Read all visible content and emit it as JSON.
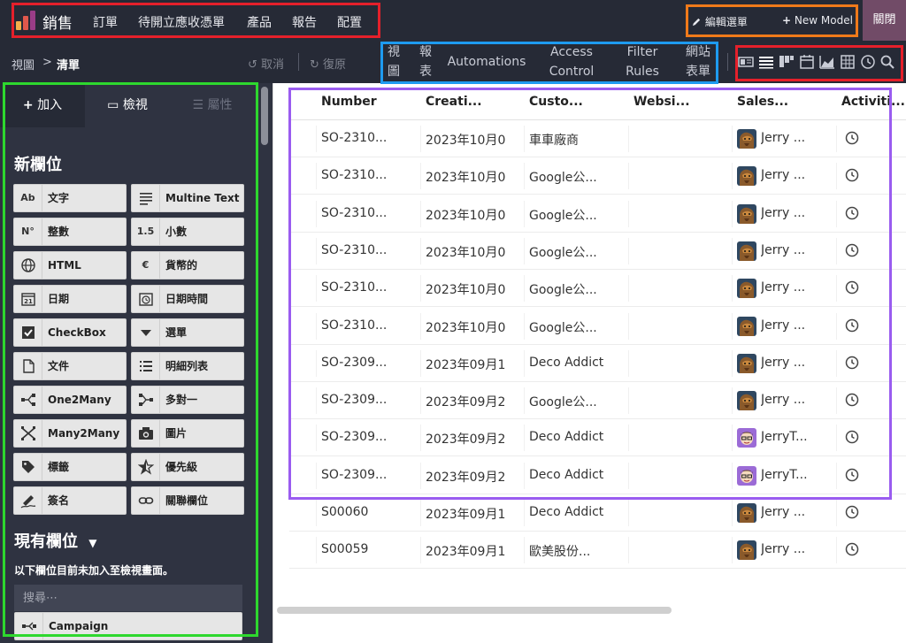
{
  "app": {
    "title": "銷售",
    "menu": [
      "訂單",
      "待開立應收憑單",
      "產品",
      "報告",
      "配置"
    ],
    "edit_menu": "編輯選單",
    "new_model": "New Model",
    "close": "關閉"
  },
  "toolbar": {
    "breadcrumb_root": "視圖",
    "breadcrumb_sep": ">",
    "breadcrumb_current": "清單",
    "undo": "取消",
    "redo": "復原",
    "view_tabs": [
      {
        "l1": "視",
        "l2": "圖"
      },
      {
        "l1": "報",
        "l2": "表"
      },
      {
        "l1": "Automations",
        "l2": ""
      },
      {
        "l1": "Access",
        "l2": "Control"
      },
      {
        "l1": "Filter",
        "l2": "Rules"
      },
      {
        "l1": "網站",
        "l2": "表單"
      }
    ],
    "view_icons": [
      "form-view-icon",
      "list-view-icon",
      "kanban-view-icon",
      "calendar-view-icon",
      "graph-view-icon",
      "pivot-view-icon",
      "activity-view-icon",
      "search-view-icon"
    ]
  },
  "sidebar": {
    "tabs": [
      "加入",
      "檢視",
      "屬性"
    ],
    "new_fields_title": "新欄位",
    "fields": [
      {
        "icon": "Ab",
        "label": "文字"
      },
      {
        "icon": "lines",
        "label": "Multine Text"
      },
      {
        "icon": "N°",
        "label": "整數"
      },
      {
        "icon": "1.5",
        "label": "小數"
      },
      {
        "icon": "globe",
        "label": "HTML"
      },
      {
        "icon": "€",
        "label": "貨幣的"
      },
      {
        "icon": "21",
        "label": "日期"
      },
      {
        "icon": "clock",
        "label": "日期時間"
      },
      {
        "icon": "check",
        "label": "CheckBox"
      },
      {
        "icon": "caret",
        "label": "選單"
      },
      {
        "icon": "file",
        "label": "文件"
      },
      {
        "icon": "list",
        "label": "明細列表"
      },
      {
        "icon": "o2m",
        "label": "One2Many"
      },
      {
        "icon": "m2o",
        "label": "多對一"
      },
      {
        "icon": "m2m",
        "label": "Many2Many"
      },
      {
        "icon": "camera",
        "label": "圖片"
      },
      {
        "icon": "tag",
        "label": "標籤"
      },
      {
        "icon": "star",
        "label": "優先級"
      },
      {
        "icon": "sign",
        "label": "簽名"
      },
      {
        "icon": "link",
        "label": "關聯欄位"
      }
    ],
    "existing_title": "現有欄位",
    "note": "以下欄位目前未加入至檢視畫面。",
    "search_placeholder": "搜尋⋯",
    "existing_fields": [
      "Campaign"
    ]
  },
  "table": {
    "headers": [
      "Number",
      "Creati...",
      "Custo...",
      "Websi...",
      "Sales...",
      "Activiti..."
    ],
    "rows": [
      {
        "number": "SO-2310...",
        "date": "2023年10月0",
        "customer": "車車廠商",
        "website": "",
        "sales": "Jerry ...",
        "avatar": "a"
      },
      {
        "number": "SO-2310...",
        "date": "2023年10月0",
        "customer": "Google公...",
        "website": "",
        "sales": "Jerry ...",
        "avatar": "a"
      },
      {
        "number": "SO-2310...",
        "date": "2023年10月0",
        "customer": "Google公...",
        "website": "",
        "sales": "Jerry ...",
        "avatar": "a"
      },
      {
        "number": "SO-2310...",
        "date": "2023年10月0",
        "customer": "Google公...",
        "website": "",
        "sales": "Jerry ...",
        "avatar": "a"
      },
      {
        "number": "SO-2310...",
        "date": "2023年10月0",
        "customer": "Google公...",
        "website": "",
        "sales": "Jerry ...",
        "avatar": "a"
      },
      {
        "number": "SO-2310...",
        "date": "2023年10月0",
        "customer": "Google公...",
        "website": "",
        "sales": "Jerry ...",
        "avatar": "a"
      },
      {
        "number": "SO-2309...",
        "date": "2023年09月1",
        "customer": "Deco Addict",
        "website": "",
        "sales": "Jerry ...",
        "avatar": "a"
      },
      {
        "number": "SO-2309...",
        "date": "2023年09月2",
        "customer": "Google公...",
        "website": "",
        "sales": "Jerry ...",
        "avatar": "a"
      },
      {
        "number": "SO-2309...",
        "date": "2023年09月2",
        "customer": "Deco Addict",
        "website": "",
        "sales": "JerryT...",
        "avatar": "b"
      },
      {
        "number": "SO-2309...",
        "date": "2023年09月2",
        "customer": "Deco Addict",
        "website": "",
        "sales": "JerryT...",
        "avatar": "b"
      },
      {
        "number": "S00060",
        "date": "2023年09月1",
        "customer": "Deco Addict",
        "website": "",
        "sales": "Jerry ...",
        "avatar": "a"
      },
      {
        "number": "S00059",
        "date": "2023年09月1",
        "customer": "歐美股份...",
        "website": "",
        "sales": "Jerry ...",
        "avatar": "a"
      }
    ]
  },
  "colors": {
    "topbar": "#262a36",
    "sidebar": "#2f3341",
    "brand": "#714b67",
    "highlight_red": "#e5202b",
    "highlight_orange": "#f07a1a",
    "highlight_blue": "#1e9bf0",
    "highlight_green": "#2ed82e",
    "highlight_purple": "#9a5cf0"
  }
}
